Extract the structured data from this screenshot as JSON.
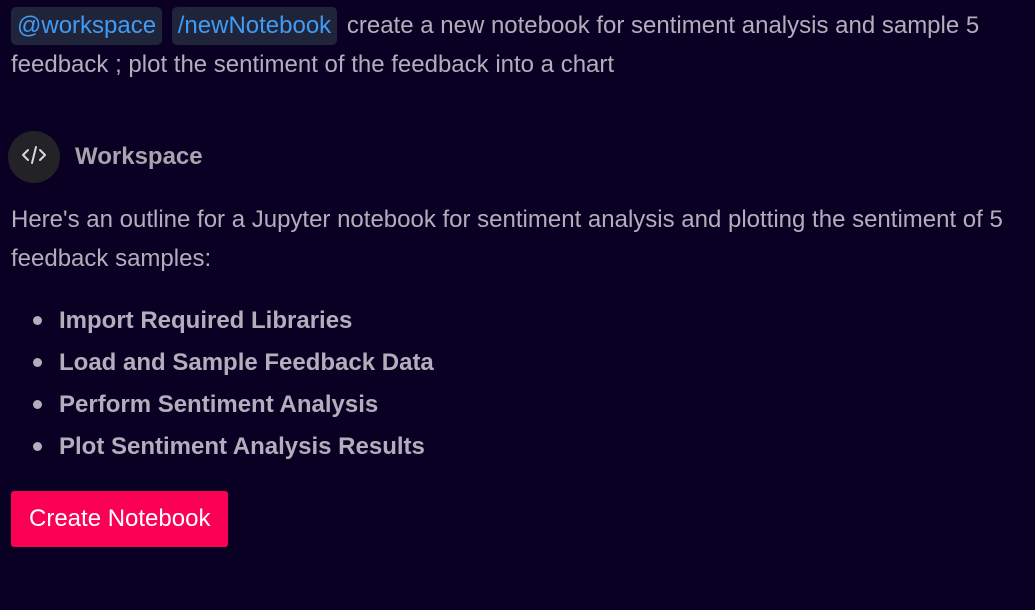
{
  "user_message": {
    "chips": [
      "@workspace",
      "/newNotebook"
    ],
    "text": "create a new notebook for sentiment analysis and sample 5 feedback ; plot the sentiment of the feedback into a chart"
  },
  "reply": {
    "agent_name": "Workspace",
    "avatar_icon": "code-icon",
    "intro": "Here's an outline for a Jupyter notebook for sentiment analysis and plotting the sentiment of 5 feedback samples:",
    "outline": [
      "Import Required Libraries",
      "Load and Sample Feedback Data",
      "Perform Sentiment Analysis",
      "Plot Sentiment Analysis Results"
    ],
    "action_button": "Create Notebook"
  },
  "colors": {
    "background": "#0a0023",
    "chip_background": "#20243b",
    "chip_text": "#3f9bf3",
    "button": "#fa0155",
    "text": "#b3aebc"
  }
}
